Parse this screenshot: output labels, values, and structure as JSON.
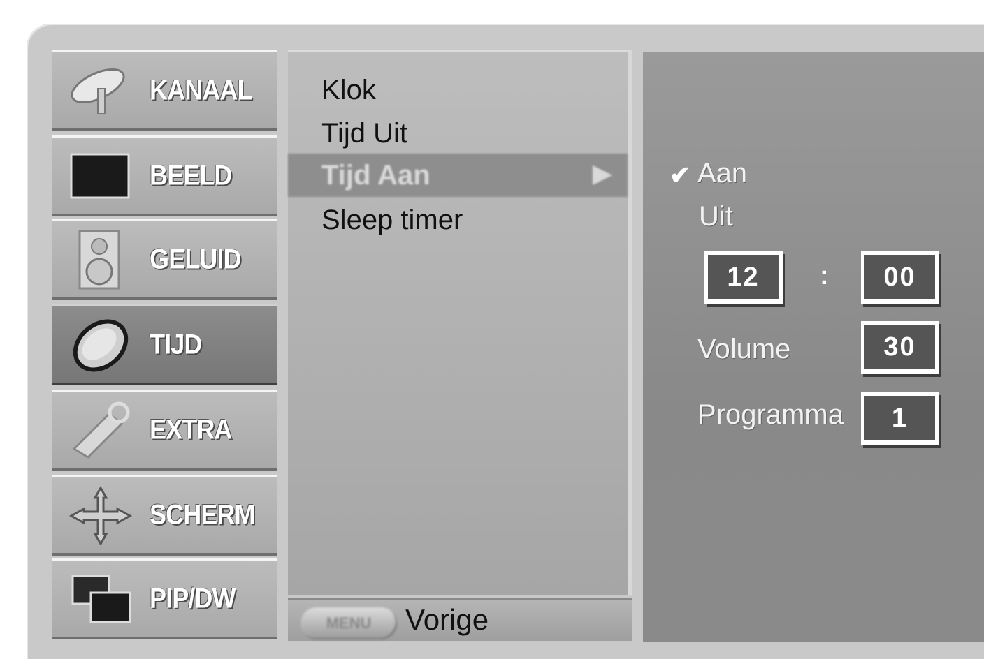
{
  "categories": [
    {
      "label": "KANAAL",
      "icon": "satellite-dish-icon"
    },
    {
      "label": "BEELD",
      "icon": "picture-icon"
    },
    {
      "label": "GELUID",
      "icon": "speaker-icon"
    },
    {
      "label": "TIJD",
      "icon": "clock-icon",
      "active": true
    },
    {
      "label": "EXTRA",
      "icon": "extra-icon"
    },
    {
      "label": "SCHERM",
      "icon": "screen-move-icon"
    },
    {
      "label": "PIP/DW",
      "icon": "pip-icon"
    }
  ],
  "menu": {
    "items": [
      "Klok",
      "Tijd Uit",
      "Tijd Aan",
      "Sleep timer"
    ],
    "selected_index": 2
  },
  "footer": {
    "button_label": "MENU",
    "back_label": "Vorige"
  },
  "submenu": {
    "option_on": "Aan",
    "option_on_checked": true,
    "option_off": "Uit",
    "time_hour": "12",
    "time_separator": ":",
    "time_minute": "00",
    "volume_label": "Volume",
    "volume_value": "30",
    "program_label": "Programma",
    "program_value": "1"
  },
  "colors": {
    "panel_light": "#bdbdbd",
    "panel_dark": "#8a8a8a",
    "active_category": "#7f7f7f",
    "selected_row": "#8e8e8e"
  }
}
